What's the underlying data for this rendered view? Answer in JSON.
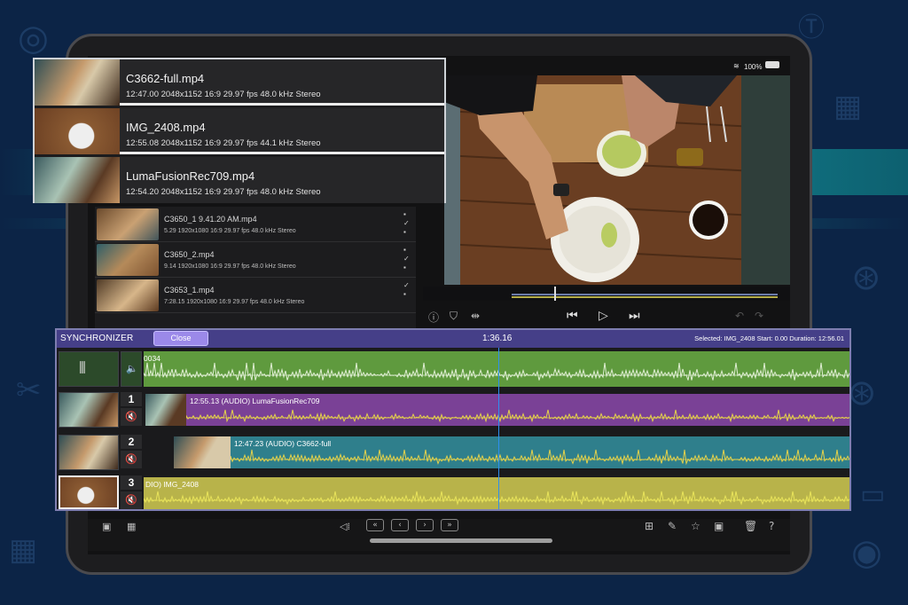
{
  "status": {
    "battery": "100%"
  },
  "media_browser": {
    "items": [
      {
        "name": "C3650_1 9.41.20 AM.mp4",
        "info": "5.29  1920x1080  16:9  29.97 fps  48.0 kHz  Stereo"
      },
      {
        "name": "C3650_2.mp4",
        "info": "9.14  1920x1080  16:9  29.97 fps  48.0 kHz  Stereo"
      },
      {
        "name": "C3653_1.mp4",
        "info": "7:28.15  1920x1080  16:9  29.97 fps  48.0 kHz  Stereo"
      }
    ]
  },
  "popup": {
    "items": [
      {
        "name": "C3662-full.mp4",
        "info": "12:47.00  2048x1152  16:9  29.97 fps  48.0 kHz  Stereo"
      },
      {
        "name": "IMG_2408.mp4",
        "info": "12:55.08  2048x1152  16:9  29.97 fps  44.1 kHz  Stereo"
      },
      {
        "name": "LumaFusionRec709.mp4",
        "info": "12:54.20  2048x1152  16:9  29.97 fps  48.0 kHz  Stereo"
      }
    ]
  },
  "synchronizer": {
    "title": "SYNCHRONIZER",
    "close_label": "Close",
    "time": "1:36.16",
    "selection": "Selected: IMG_2408 Start: 0.00 Duration: 12:56.01",
    "tracks": [
      {
        "number": "",
        "label": "0034",
        "color": "#5f9a3e"
      },
      {
        "number": "1",
        "label": "12:55.13 (AUDIO)   LumaFusionRec709",
        "color": "#7a4196"
      },
      {
        "number": "2",
        "label": "12:47.23 (AUDIO)   C3662-full",
        "color": "#2f7f8c"
      },
      {
        "number": "3",
        "label": "DIO)   IMG_2408",
        "color": "#b8b34a"
      }
    ]
  },
  "colors": {
    "accent": "#453f88",
    "close_button": "#9b89e9",
    "playhead": "#2d8ff0"
  },
  "icons": [
    "wifi-icon",
    "battery-icon",
    "check-circle-icon",
    "search-icon",
    "info-icon",
    "marker-icon",
    "split-icon",
    "skip-back-icon",
    "play-icon",
    "skip-forward-icon",
    "waveform-icon",
    "speaker-icon",
    "mute-icon",
    "rewind-icon",
    "step-back-icon",
    "step-forward-icon",
    "fast-forward-icon",
    "add-icon",
    "pencil-icon",
    "star-icon",
    "trash-icon",
    "help-icon"
  ]
}
